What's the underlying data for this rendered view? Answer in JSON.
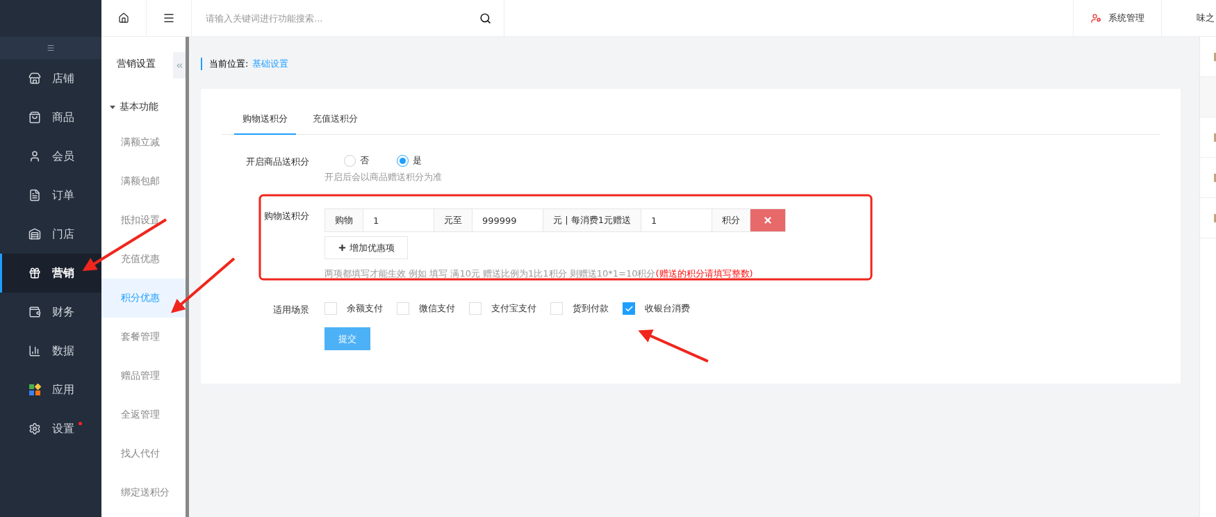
{
  "sidebar": {
    "items": [
      {
        "label": "店铺",
        "selected": false,
        "dot": false
      },
      {
        "label": "商品",
        "selected": false,
        "dot": false
      },
      {
        "label": "会员",
        "selected": false,
        "dot": false
      },
      {
        "label": "订单",
        "selected": false,
        "dot": false
      },
      {
        "label": "门店",
        "selected": false,
        "dot": false
      },
      {
        "label": "营销",
        "selected": true,
        "dot": false
      },
      {
        "label": "财务",
        "selected": false,
        "dot": false
      },
      {
        "label": "数据",
        "selected": false,
        "dot": false
      },
      {
        "label": "应用",
        "selected": false,
        "dot": false
      },
      {
        "label": "设置",
        "selected": false,
        "dot": true
      }
    ]
  },
  "submenu": {
    "title": "营销设置",
    "group": {
      "label": "基本功能",
      "expanded": true
    },
    "items": [
      {
        "label": "满额立减",
        "selected": false
      },
      {
        "label": "满额包邮",
        "selected": false
      },
      {
        "label": "抵扣设置",
        "selected": false
      },
      {
        "label": "充值优惠",
        "selected": false
      },
      {
        "label": "积分优惠",
        "selected": true
      },
      {
        "label": "套餐管理",
        "selected": false
      },
      {
        "label": "赠品管理",
        "selected": false
      },
      {
        "label": "全返管理",
        "selected": false
      },
      {
        "label": "找人代付",
        "selected": false
      },
      {
        "label": "绑定送积分",
        "selected": false
      }
    ]
  },
  "topbar": {
    "search": {
      "placeholder": "请输入关键词进行功能搜索..."
    },
    "admin": "系统管理",
    "user": "味之"
  },
  "breadcrumb": {
    "label": "当前位置:",
    "current": "基础设置"
  },
  "tabs": [
    {
      "label": "购物送积分",
      "selected": true
    },
    {
      "label": "充值送积分",
      "selected": false
    }
  ],
  "form": {
    "enable": {
      "label": "开启商品送积分",
      "options": [
        {
          "label": "否",
          "selected": false
        },
        {
          "label": "是",
          "selected": true
        }
      ],
      "hint": "开启后会以商品赠送积分为准"
    },
    "rule": {
      "label": "购物送积分",
      "parts": [
        {
          "kind": "addon",
          "text": "购物"
        },
        {
          "kind": "input",
          "text": "1"
        },
        {
          "kind": "addon",
          "text": "元至"
        },
        {
          "kind": "input",
          "text": "999999"
        },
        {
          "kind": "addon",
          "text": "元 | 每消费1元赠送"
        },
        {
          "kind": "input",
          "text": "1"
        },
        {
          "kind": "addon",
          "text": "积分"
        }
      ],
      "add_button": "增加优惠项",
      "hint": "两项都填写才能生效 例如 填写 满10元 赠送比例为1比1积分 则赠送10*1=10积分",
      "warning": "(赠送的积分请填写整数)"
    },
    "scenes": {
      "label": "适用场景",
      "options": [
        {
          "label": "余额支付",
          "checked": false
        },
        {
          "label": "微信支付",
          "checked": false
        },
        {
          "label": "支付宝支付",
          "checked": false
        },
        {
          "label": "货到付款",
          "checked": false
        },
        {
          "label": "收银台消费",
          "checked": true
        }
      ]
    },
    "submit": "提交"
  }
}
